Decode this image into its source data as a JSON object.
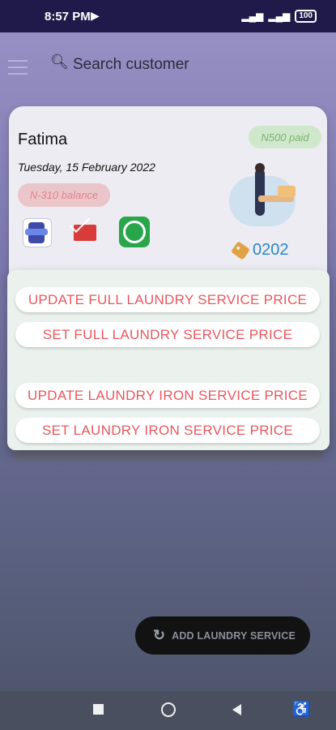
{
  "status_bar": {
    "time": "8:57 PM",
    "battery": "100"
  },
  "header": {
    "search_placeholder": "Search customer"
  },
  "card": {
    "customer_name": "Fatima",
    "date": "Tuesday, 15 February 2022",
    "paid_label": "N500 paid",
    "balance_label": "N-310 balance",
    "tag_code": "0202"
  },
  "menu": {
    "options": [
      "UPDATE FULL LAUNDRY SERVICE PRICE",
      "SET FULL LAUNDRY SERVICE PRICE",
      "UPDATE LAUNDRY IRON SERVICE PRICE",
      "SET LAUNDRY IRON SERVICE PRICE"
    ]
  },
  "fab": {
    "label": "ADD LAUNDRY SERVICE"
  },
  "colors": {
    "status_bar": "#1f1a4a",
    "menu_text": "#e8575e",
    "paid_text": "#7bb36f",
    "balance_text": "#e6818a",
    "tag_code": "#2b87c8",
    "whatsapp": "#2aa64a"
  }
}
